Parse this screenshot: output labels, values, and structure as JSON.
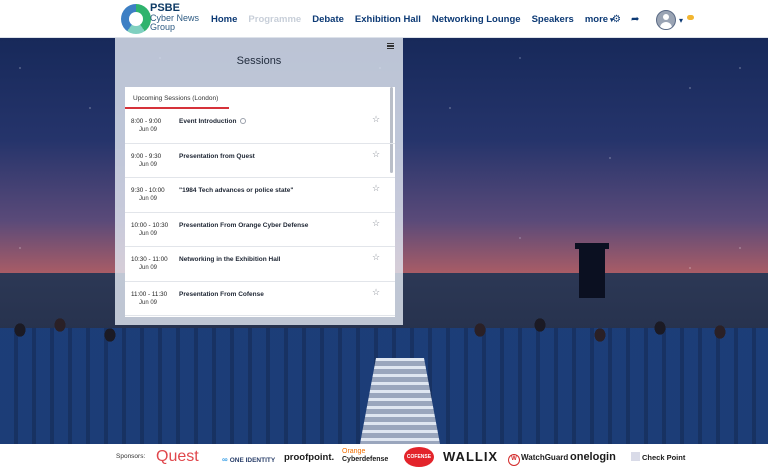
{
  "brand": {
    "line1": "PSBE",
    "line2": "Cyber News",
    "line3": "Group"
  },
  "nav": [
    {
      "label": "Home"
    },
    {
      "label": "Programme"
    },
    {
      "label": "Debate"
    },
    {
      "label": "Exhibition Hall"
    },
    {
      "label": "Networking Lounge"
    },
    {
      "label": "Speakers"
    },
    {
      "label": "more"
    }
  ],
  "icons": {
    "settings": "gear-icon",
    "share": "share-icon",
    "user": "avatar",
    "chat": "chat-icon"
  },
  "sessions": {
    "title": "Sessions",
    "tab_label": "Upcoming Sessions (London)",
    "items": [
      {
        "time": "8:00 - 9:00",
        "date": "Jun 09",
        "title": "Event Introduction",
        "has_info": true
      },
      {
        "time": "9:00 - 9:30",
        "date": "Jun 09",
        "title": "Presentation from Quest",
        "has_info": false
      },
      {
        "time": "9:30 - 10:00",
        "date": "Jun 09",
        "title": "\"1984 Tech advances or police state\"",
        "has_info": false
      },
      {
        "time": "10:00 - 10:30",
        "date": "Jun 09",
        "title": "Presentation From Orange Cyber Defense",
        "has_info": false
      },
      {
        "time": "10:30 - 11:00",
        "date": "Jun 09",
        "title": "Networking in the Exhibition Hall",
        "has_info": false
      },
      {
        "time": "11:00 - 11:30",
        "date": "Jun 09",
        "title": "Presentation From Cofense",
        "has_info": false
      }
    ]
  },
  "sponsors": {
    "label": "Sponsors:",
    "items": [
      "Quest",
      "ONE IDENTITY",
      "proofpoint.",
      "Orange",
      "Cyberdefense",
      "COFENSE",
      "WALLIX",
      "WatchGuard",
      "onelogin",
      "Check Point"
    ]
  },
  "colors": {
    "accent": "#d6323a",
    "nav": "#0d3a75"
  }
}
